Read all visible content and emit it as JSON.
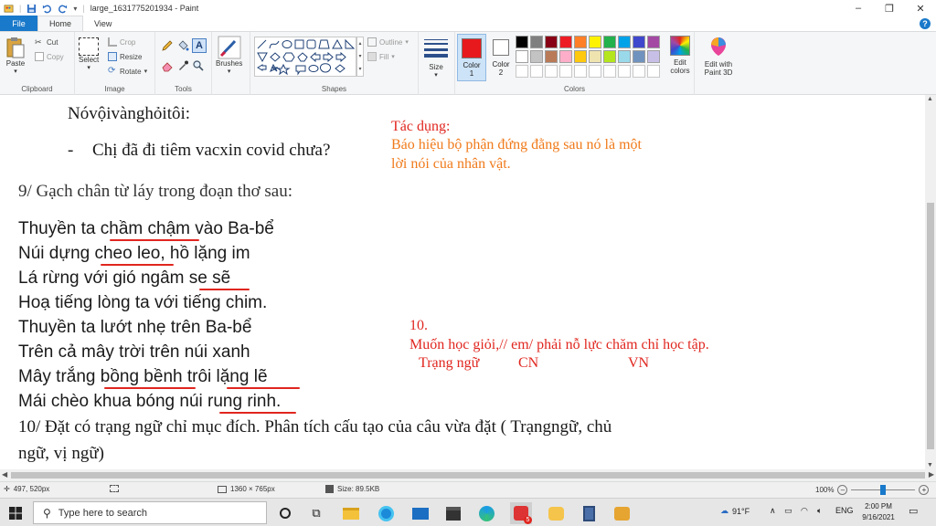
{
  "window": {
    "title": "large_1631775201934 - Paint"
  },
  "tabs": [
    {
      "label": "File"
    },
    {
      "label": "Home"
    },
    {
      "label": "View"
    }
  ],
  "ribbon": {
    "clipboard": {
      "paste": "Paste",
      "cut": "Cut",
      "copy": "Copy",
      "label": "Clipboard"
    },
    "image": {
      "select": "Select",
      "crop": "Crop",
      "resize": "Resize",
      "rotate": "Rotate",
      "label": "Image"
    },
    "tools": {
      "label": "Tools"
    },
    "brushes": {
      "label": "Brushes"
    },
    "shapes": {
      "outline": "Outline",
      "fill": "Fill",
      "label": "Shapes"
    },
    "size": {
      "label": "Size"
    },
    "color1": {
      "line1": "Color",
      "line2": "1",
      "value": "#e8191c"
    },
    "color2": {
      "line1": "Color",
      "line2": "2",
      "value": "#ffffff"
    },
    "colors": {
      "label": "Colors",
      "row1": [
        "#000000",
        "#7f7f7f",
        "#880015",
        "#ed1c24",
        "#ff7f27",
        "#fff200",
        "#22b14c",
        "#00a2e8",
        "#3f48cc",
        "#a349a4"
      ],
      "row2": [
        "#ffffff",
        "#c3c3c3",
        "#b97a57",
        "#ffaec9",
        "#ffc90e",
        "#efe4b0",
        "#b5e61d",
        "#99d9ea",
        "#7092be",
        "#c8bfe7"
      ]
    },
    "edit_colors": {
      "line1": "Edit",
      "line2": "colors"
    },
    "paint3d": {
      "line1": "Edit with",
      "line2": "Paint 3D"
    }
  },
  "canvas": {
    "line1": "Nóvộivànghỏitôi:",
    "bullet_dash": "-",
    "line2": "Chị đã đi tiêm vacxin covid chưa?",
    "tacdung_title": "Tác dụng:",
    "tacdung_line1": "Báo hiệu bộ phận đứng đằng sau nó là một",
    "tacdung_line2": "lời nói của nhân vật.",
    "q9": "9/ Gạch chân từ láy trong đoạn thơ sau:",
    "poem": [
      "Thuyền ta chầm chậm vào Ba-bể",
      "Núi dựng cheo leo, hồ lặng im",
      "Lá rừng với gió ngâm se sẽ",
      "Hoạ tiếng lòng ta với tiếng chim.",
      "Thuyền ta lướt nhẹ trên Ba-bể",
      "Trên cả mây trời trên núi xanh",
      "Mây trắng bồng bềnh trôi lặng lẽ",
      "Mái chèo khua bóng núi rung rinh."
    ],
    "ans10_num": "10.",
    "ans10_sentence": "Muốn học giỏi,// em/ phải nỗ lực chăm chỉ học tập.",
    "ans10_tn": "Trạng ngữ",
    "ans10_cn": "CN",
    "ans10_vn": "VN",
    "q10_line1": "10/ Đặt có trạng ngữ chỉ mục đích. Phân tích cấu tạo của câu vừa đặt ( Trạngngữ, chủ",
    "q10_line2": "ngữ, vị ngữ)"
  },
  "statusbar": {
    "cursor": "497, 520px",
    "dimensions": "1360 × 765px",
    "size": "Size: 89.5KB",
    "zoom": "100%",
    "zoom_fraction": 0.5
  },
  "taskbar": {
    "search_placeholder": "Type here to search",
    "weather": "91°F",
    "language": "ENG",
    "time": "2:00 PM",
    "date": "9/16/2021",
    "badge_count": "5"
  }
}
